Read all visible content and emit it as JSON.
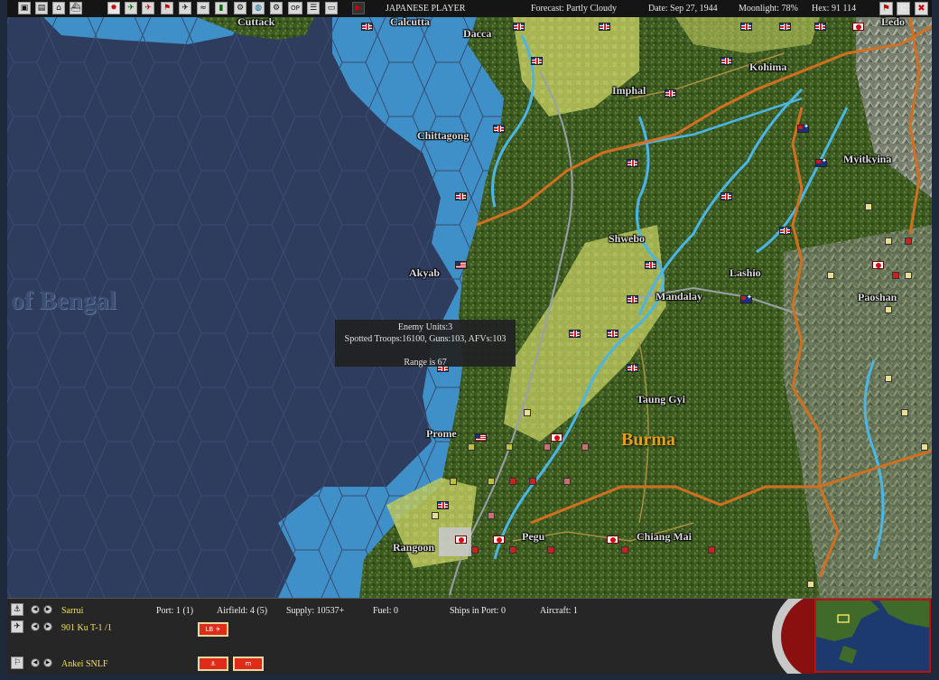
{
  "toolbar": {
    "player": "JAPANESE PLAYER",
    "forecast": "Forecast: Partly Cloudy",
    "date": "Date: Sep 27, 1944",
    "moonlight": "Moonlight: 78%",
    "hex": "Hex: 91 114",
    "buttons": [
      "map-icon",
      "report-icon",
      "base-icon",
      "ship-icon",
      "rising-sun-icon",
      "aircraft-icon",
      "plane-red-icon",
      "flag-icon",
      "plane-icon",
      "wave-icon",
      "supply-icon",
      "task-icon",
      "globe-icon",
      "options-icon",
      "op-icon",
      "list-icon",
      "window-icon",
      "play-icon"
    ],
    "op_label": "OP",
    "right_c_label": "C",
    "right_x_label": "✖"
  },
  "map": {
    "cities": [
      {
        "name": "Cuttack"
      },
      {
        "name": "Calcutta"
      },
      {
        "name": "Dacca"
      },
      {
        "name": "Ledo"
      },
      {
        "name": "Kohima"
      },
      {
        "name": "Imphal"
      },
      {
        "name": "Chittagong"
      },
      {
        "name": "Myitkyina"
      },
      {
        "name": "Shwebo"
      },
      {
        "name": "Lashio"
      },
      {
        "name": "Akyab"
      },
      {
        "name": "Mandalay"
      },
      {
        "name": "Paoshan"
      },
      {
        "name": "Taung Gyi"
      },
      {
        "name": "Prome"
      },
      {
        "name": "Pegu"
      },
      {
        "name": "Chiang Mai"
      },
      {
        "name": "Rangoon"
      }
    ],
    "region_label": "Burma",
    "sea_label": "of Bengal"
  },
  "tooltip": {
    "line1": "Enemy Units:3",
    "line2": "Spotted Troops:16100, Guns:103, AFVs:103",
    "line3": "Range is 67"
  },
  "bottom": {
    "base_name": "Sarrui",
    "air_unit": "901 Ku T-1 /1",
    "ground_unit": "Ankei SNLF",
    "port": "Port: 1 (1)",
    "airfield": "Airfield: 4 (5)",
    "supply": "Supply: 10537+",
    "fuel": "Fuel: 0",
    "ships_in_port": "Ships in Port: 0",
    "aircraft": "Aircraft: 1",
    "lb_label": "LB",
    "m_label": "m"
  },
  "colors": {
    "deep_sea": "#2e3d5e",
    "shallow_sea": "#3f90c8",
    "land": "#3d5a22",
    "river": "#4ab6e8",
    "border": "#d07020",
    "region_text": "#e0a020"
  }
}
